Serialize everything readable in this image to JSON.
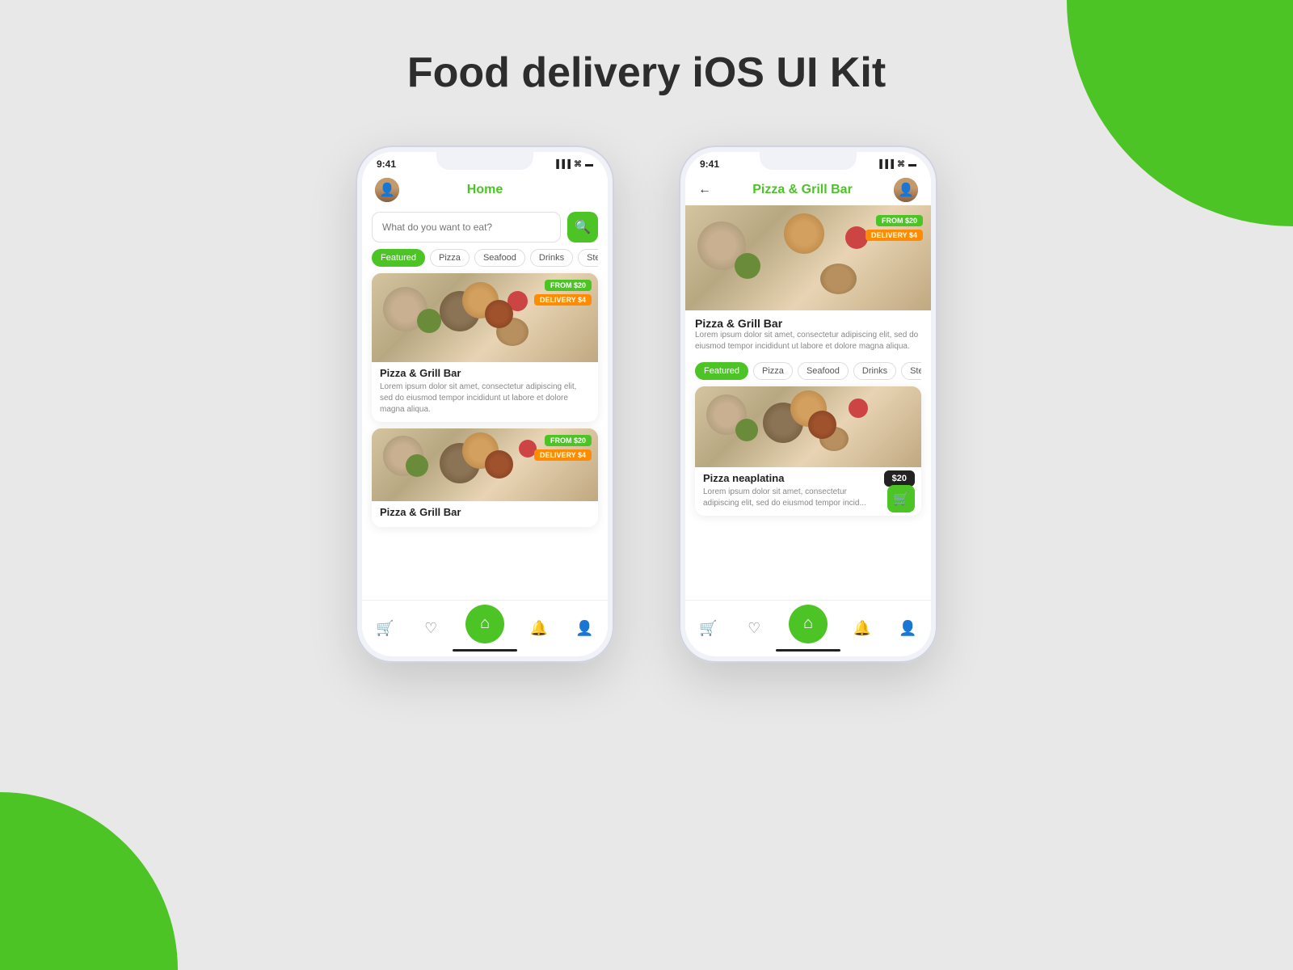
{
  "page": {
    "title": "Food delivery iOS UI Kit",
    "bg_color": "#e8e8e8",
    "accent_color": "#4cc426"
  },
  "phone1": {
    "status": {
      "time": "9:41",
      "signal": "▐▐▐",
      "wifi": "wifi",
      "battery": "■"
    },
    "nav": {
      "title": "Home",
      "has_avatar": true
    },
    "search": {
      "placeholder": "What do you want to eat?"
    },
    "categories": [
      "Featured",
      "Pizza",
      "Seafood",
      "Drinks",
      "Steak"
    ],
    "active_category": "Featured",
    "cards": [
      {
        "name": "Pizza & Grill Bar",
        "desc": "Lorem ipsum dolor sit amet, consectetur adipiscing elit, sed do eiusmod tempor incididunt ut labore et dolore magna aliqua.",
        "price_tag": "FROM $20",
        "delivery_tag": "DELIVERY $4"
      },
      {
        "name": "Pizza & Grill Bar",
        "desc": "",
        "price_tag": "FROM $20",
        "delivery_tag": "DELIVERY $4"
      }
    ],
    "bottom_nav": [
      "cart",
      "heart",
      "home",
      "bell",
      "user"
    ]
  },
  "phone2": {
    "status": {
      "time": "9:41",
      "signal": "▐▐▐",
      "wifi": "wifi",
      "battery": "■"
    },
    "nav": {
      "title": "Pizza & Grill Bar",
      "has_back": true,
      "has_avatar": true
    },
    "header_img": {
      "price_tag": "FROM $20",
      "delivery_tag": "DELIVERY $4"
    },
    "restaurant": {
      "name": "Pizza & Grill Bar",
      "desc": "Lorem ipsum dolor sit amet, consectetur adipiscing elit, sed do eiusmod tempor incididunt ut labore et dolore magna aliqua."
    },
    "categories": [
      "Featured",
      "Pizza",
      "Seafood",
      "Drinks",
      "Steak"
    ],
    "active_category": "Featured",
    "cards": [
      {
        "name": "Pizza neaplatina",
        "desc": "Lorem ipsum dolor sit amet, consectetur adipiscing elit, sed do eiusmod tempor incid...",
        "price": "$20"
      }
    ],
    "bottom_nav": [
      "cart",
      "heart",
      "home",
      "bell",
      "user"
    ]
  }
}
